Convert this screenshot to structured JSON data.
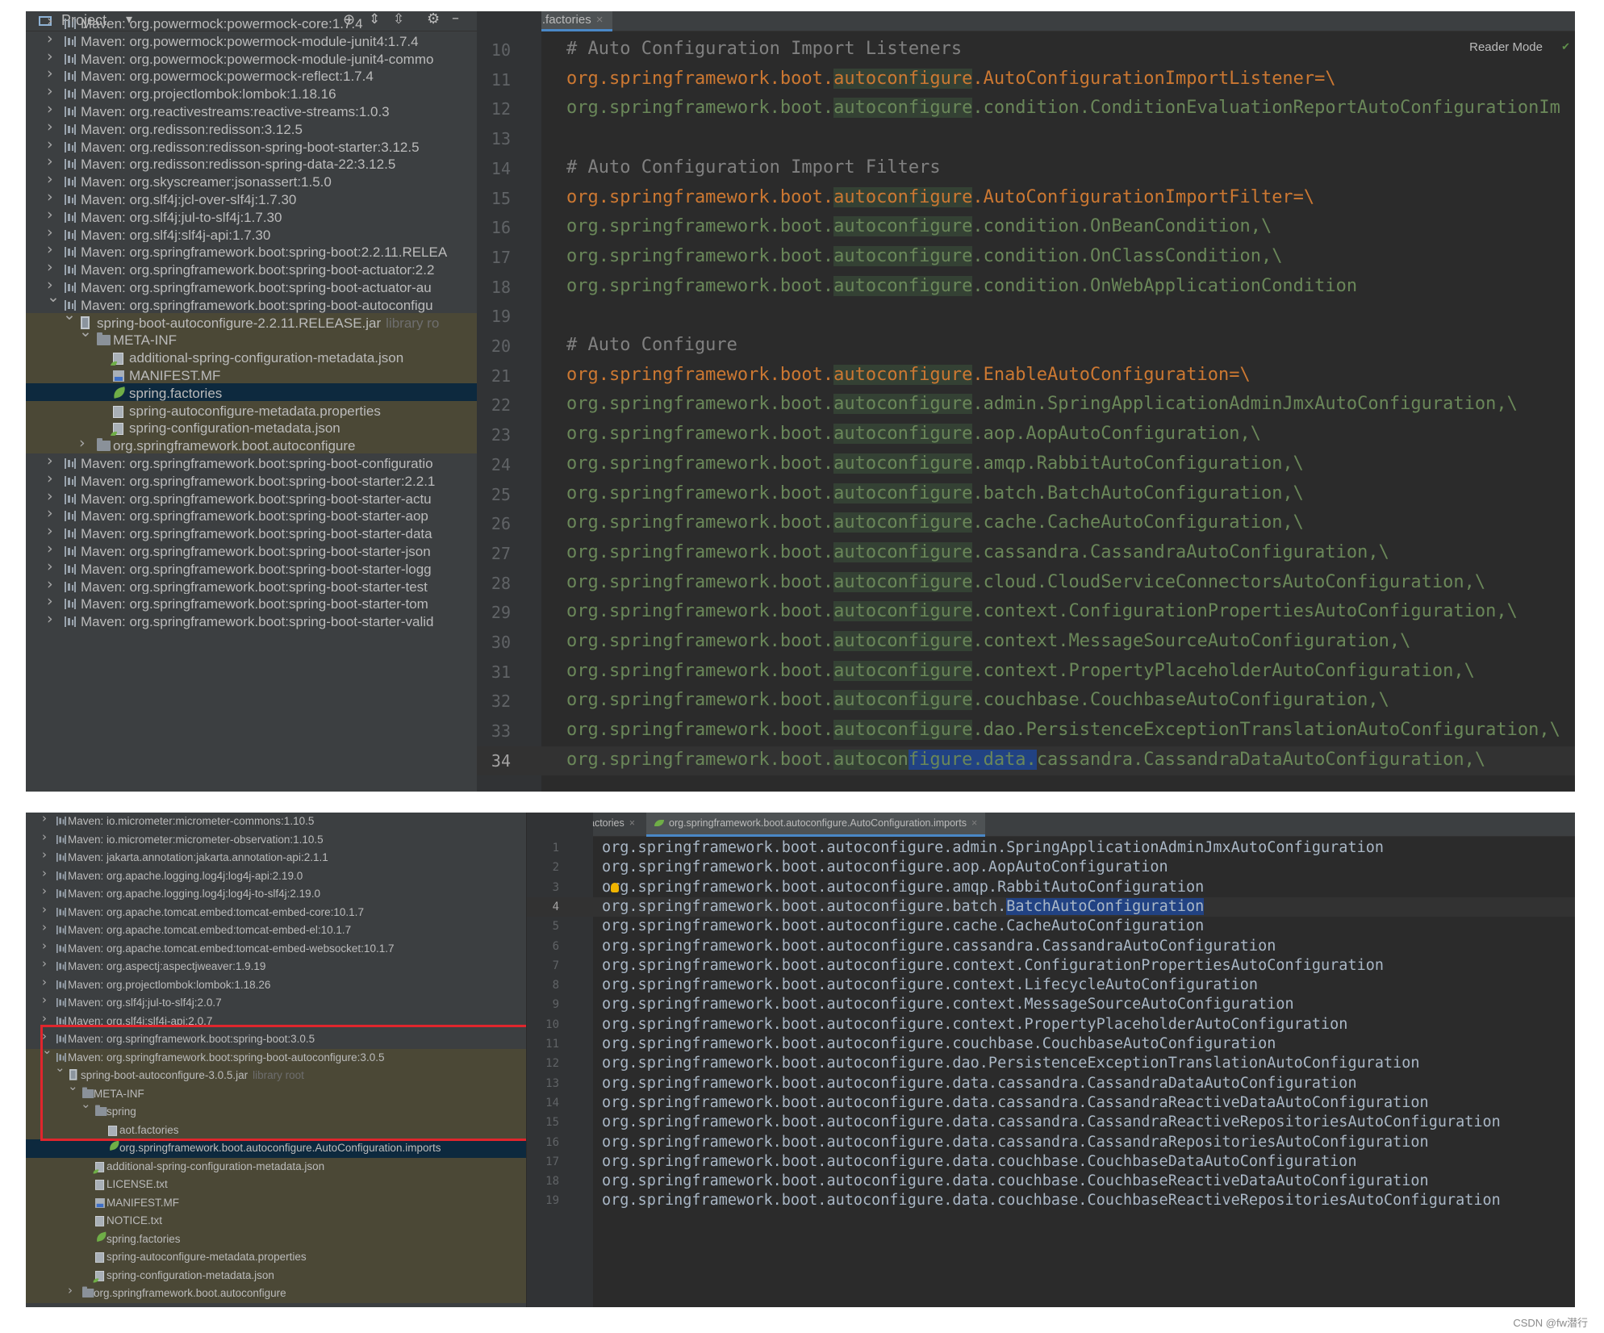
{
  "shot1": {
    "panel_title": "Project",
    "tree_rows": [
      {
        "arrow": "›",
        "icon": "lib",
        "text": "Maven: org.powermock:powermock-core:1.7.4"
      },
      {
        "arrow": "›",
        "icon": "lib",
        "text": "Maven: org.powermock:powermock-module-junit4:1.7.4"
      },
      {
        "arrow": "›",
        "icon": "lib",
        "text": "Maven: org.powermock:powermock-module-junit4-commo"
      },
      {
        "arrow": "›",
        "icon": "lib",
        "text": "Maven: org.powermock:powermock-reflect:1.7.4"
      },
      {
        "arrow": "›",
        "icon": "lib",
        "text": "Maven: org.projectlombok:lombok:1.18.16"
      },
      {
        "arrow": "›",
        "icon": "lib",
        "text": "Maven: org.reactivestreams:reactive-streams:1.0.3"
      },
      {
        "arrow": "›",
        "icon": "lib",
        "text": "Maven: org.redisson:redisson:3.12.5"
      },
      {
        "arrow": "›",
        "icon": "lib",
        "text": "Maven: org.redisson:redisson-spring-boot-starter:3.12.5"
      },
      {
        "arrow": "›",
        "icon": "lib",
        "text": "Maven: org.redisson:redisson-spring-data-22:3.12.5"
      },
      {
        "arrow": "›",
        "icon": "lib",
        "text": "Maven: org.skyscreamer:jsonassert:1.5.0"
      },
      {
        "arrow": "›",
        "icon": "lib",
        "text": "Maven: org.slf4j:jcl-over-slf4j:1.7.30"
      },
      {
        "arrow": "›",
        "icon": "lib",
        "text": "Maven: org.slf4j:jul-to-slf4j:1.7.30"
      },
      {
        "arrow": "›",
        "icon": "lib",
        "text": "Maven: org.slf4j:slf4j-api:1.7.30"
      },
      {
        "arrow": "›",
        "icon": "lib",
        "text": "Maven: org.springframework.boot:spring-boot:2.2.11.RELEA"
      },
      {
        "arrow": "›",
        "icon": "lib",
        "text": "Maven: org.springframework.boot:spring-boot-actuator:2.2"
      },
      {
        "arrow": "›",
        "icon": "lib",
        "text": "Maven: org.springframework.boot:spring-boot-actuator-au"
      },
      {
        "arrow": "⌄",
        "icon": "lib",
        "text": "Maven: org.springframework.boot:spring-boot-autoconfigu"
      },
      {
        "arrow": "⌄",
        "icon": "jar",
        "text": "spring-boot-autoconfigure-2.2.11.RELEASE.jar",
        "lib": "library ro"
      },
      {
        "arrow": "⌄",
        "icon": "folder",
        "text": "META-INF"
      },
      {
        "arrow": "",
        "icon": "json",
        "text": "additional-spring-configuration-metadata.json"
      },
      {
        "arrow": "",
        "icon": "mf",
        "text": "MANIFEST.MF"
      },
      {
        "arrow": "",
        "icon": "leaf",
        "text": "spring.factories"
      },
      {
        "arrow": "",
        "icon": "file",
        "text": "spring-autoconfigure-metadata.properties"
      },
      {
        "arrow": "",
        "icon": "json",
        "text": "spring-configuration-metadata.json"
      },
      {
        "arrow": "›",
        "icon": "folder",
        "text": "org.springframework.boot.autoconfigure"
      },
      {
        "arrow": "›",
        "icon": "lib",
        "text": "Maven: org.springframework.boot:spring-boot-configuratio"
      },
      {
        "arrow": "›",
        "icon": "lib",
        "text": "Maven: org.springframework.boot:spring-boot-starter:2.2.1"
      },
      {
        "arrow": "›",
        "icon": "lib",
        "text": "Maven: org.springframework.boot:spring-boot-starter-actu"
      },
      {
        "arrow": "›",
        "icon": "lib",
        "text": "Maven: org.springframework.boot:spring-boot-starter-aop"
      },
      {
        "arrow": "›",
        "icon": "lib",
        "text": "Maven: org.springframework.boot:spring-boot-starter-data"
      },
      {
        "arrow": "›",
        "icon": "lib",
        "text": "Maven: org.springframework.boot:spring-boot-starter-json"
      },
      {
        "arrow": "›",
        "icon": "lib",
        "text": "Maven: org.springframework.boot:spring-boot-starter-logg"
      },
      {
        "arrow": "›",
        "icon": "lib",
        "text": "Maven: org.springframework.boot:spring-boot-starter-test"
      },
      {
        "arrow": "›",
        "icon": "lib",
        "text": "Maven: org.springframework.boot:spring-boot-starter-tom"
      },
      {
        "arrow": "›",
        "icon": "lib",
        "text": "Maven: org.springframework.boot:spring-boot-starter-valid"
      }
    ],
    "tab_label": "spring.factories",
    "reader_mode": "Reader Mode",
    "lines": [
      {
        "n": "10",
        "kind": "comment",
        "text": "# Auto Configuration Import Listeners"
      },
      {
        "n": "11",
        "kind": "key",
        "pre": "org.springframework.boot.",
        "ac": "autoconfigure",
        "post": ".AutoConfigurationImportListener=\\"
      },
      {
        "n": "12",
        "kind": "val",
        "pre": "org.springframework.boot.",
        "ac": "autoconfigure",
        "post": ".condition.ConditionEvaluationReportAutoConfigurationIm"
      },
      {
        "n": "13",
        "kind": "blank",
        "text": ""
      },
      {
        "n": "14",
        "kind": "comment",
        "text": "# Auto Configuration Import Filters"
      },
      {
        "n": "15",
        "kind": "key",
        "pre": "org.springframework.boot.",
        "ac": "autoconfigure",
        "post": ".AutoConfigurationImportFilter=\\"
      },
      {
        "n": "16",
        "kind": "val",
        "pre": "org.springframework.boot.",
        "ac": "autoconfigure",
        "post": ".condition.OnBeanCondition,\\"
      },
      {
        "n": "17",
        "kind": "val",
        "pre": "org.springframework.boot.",
        "ac": "autoconfigure",
        "post": ".condition.OnClassCondition,\\"
      },
      {
        "n": "18",
        "kind": "val",
        "pre": "org.springframework.boot.",
        "ac": "autoconfigure",
        "post": ".condition.OnWebApplicationCondition"
      },
      {
        "n": "19",
        "kind": "blank",
        "text": ""
      },
      {
        "n": "20",
        "kind": "comment",
        "text": "# Auto Configure"
      },
      {
        "n": "21",
        "kind": "key",
        "pre": "org.springframework.boot.",
        "ac": "autoconfigure",
        "post": ".EnableAutoConfiguration=\\"
      },
      {
        "n": "22",
        "kind": "val",
        "pre": "org.springframework.boot.",
        "ac": "autoconfigure",
        "post": ".admin.SpringApplicationAdminJmxAutoConfiguration,\\"
      },
      {
        "n": "23",
        "kind": "val",
        "pre": "org.springframework.boot.",
        "ac": "autoconfigure",
        "post": ".aop.AopAutoConfiguration,\\"
      },
      {
        "n": "24",
        "kind": "val",
        "pre": "org.springframework.boot.",
        "ac": "autoconfigure",
        "post": ".amqp.RabbitAutoConfiguration,\\"
      },
      {
        "n": "25",
        "kind": "val",
        "pre": "org.springframework.boot.",
        "ac": "autoconfigure",
        "post": ".batch.BatchAutoConfiguration,\\"
      },
      {
        "n": "26",
        "kind": "val",
        "pre": "org.springframework.boot.",
        "ac": "autoconfigure",
        "post": ".cache.CacheAutoConfiguration,\\"
      },
      {
        "n": "27",
        "kind": "val",
        "pre": "org.springframework.boot.",
        "ac": "autoconfigure",
        "post": ".cassandra.CassandraAutoConfiguration,\\"
      },
      {
        "n": "28",
        "kind": "val",
        "pre": "org.springframework.boot.",
        "ac": "autoconfigure",
        "post": ".cloud.CloudServiceConnectorsAutoConfiguration,\\"
      },
      {
        "n": "29",
        "kind": "val",
        "pre": "org.springframework.boot.",
        "ac": "autoconfigure",
        "post": ".context.ConfigurationPropertiesAutoConfiguration,\\"
      },
      {
        "n": "30",
        "kind": "val",
        "pre": "org.springframework.boot.",
        "ac": "autoconfigure",
        "post": ".context.MessageSourceAutoConfiguration,\\"
      },
      {
        "n": "31",
        "kind": "val",
        "pre": "org.springframework.boot.",
        "ac": "autoconfigure",
        "post": ".context.PropertyPlaceholderAutoConfiguration,\\"
      },
      {
        "n": "32",
        "kind": "val",
        "pre": "org.springframework.boot.",
        "ac": "autoconfigure",
        "post": ".couchbase.CouchbaseAutoConfiguration,\\"
      },
      {
        "n": "33",
        "kind": "val",
        "pre": "org.springframework.boot.",
        "ac": "autoconfigure",
        "post": ".dao.PersistenceExceptionTranslationAutoConfiguration,\\"
      },
      {
        "n": "34",
        "kind": "sel",
        "pre": "org.springframework.boot.",
        "ac1": "autocon",
        "sel": "figure.data.",
        "post": "cassandra.CassandraDataAutoConfiguration,\\"
      }
    ]
  },
  "shot2": {
    "tree_rows": [
      {
        "arrow": "›",
        "icon": "lib",
        "text": "Maven: io.micrometer:micrometer-commons:1.10.5"
      },
      {
        "arrow": "›",
        "icon": "lib",
        "text": "Maven: io.micrometer:micrometer-observation:1.10.5"
      },
      {
        "arrow": "›",
        "icon": "lib",
        "text": "Maven: jakarta.annotation:jakarta.annotation-api:2.1.1"
      },
      {
        "arrow": "›",
        "icon": "lib",
        "text": "Maven: org.apache.logging.log4j:log4j-api:2.19.0"
      },
      {
        "arrow": "›",
        "icon": "lib",
        "text": "Maven: org.apache.logging.log4j:log4j-to-slf4j:2.19.0"
      },
      {
        "arrow": "›",
        "icon": "lib",
        "text": "Maven: org.apache.tomcat.embed:tomcat-embed-core:10.1.7"
      },
      {
        "arrow": "›",
        "icon": "lib",
        "text": "Maven: org.apache.tomcat.embed:tomcat-embed-el:10.1.7"
      },
      {
        "arrow": "›",
        "icon": "lib",
        "text": "Maven: org.apache.tomcat.embed:tomcat-embed-websocket:10.1.7"
      },
      {
        "arrow": "›",
        "icon": "lib",
        "text": "Maven: org.aspectj:aspectjweaver:1.9.19"
      },
      {
        "arrow": "›",
        "icon": "lib",
        "text": "Maven: org.projectlombok:lombok:1.18.26"
      },
      {
        "arrow": "›",
        "icon": "lib",
        "text": "Maven: org.slf4j:jul-to-slf4j:2.0.7"
      },
      {
        "arrow": "›",
        "icon": "lib",
        "text": "Maven: org.slf4j:slf4j-api:2.0.7"
      },
      {
        "arrow": "›",
        "icon": "lib",
        "text": "Maven: org.springframework.boot:spring-boot:3.0.5"
      },
      {
        "arrow": "⌄",
        "icon": "lib",
        "text": "Maven: org.springframework.boot:spring-boot-autoconfigure:3.0.5"
      },
      {
        "arrow": "⌄",
        "icon": "jar",
        "text": "spring-boot-autoconfigure-3.0.5.jar",
        "lib": "library root"
      },
      {
        "arrow": "⌄",
        "icon": "folder",
        "text": "META-INF"
      },
      {
        "arrow": "⌄",
        "icon": "folder",
        "text": "spring"
      },
      {
        "arrow": "",
        "icon": "file",
        "text": "aot.factories"
      },
      {
        "arrow": "",
        "icon": "leaf",
        "text": "org.springframework.boot.autoconfigure.AutoConfiguration.imports"
      },
      {
        "arrow": "",
        "icon": "json",
        "text": "additional-spring-configuration-metadata.json"
      },
      {
        "arrow": "",
        "icon": "file",
        "text": "LICENSE.txt"
      },
      {
        "arrow": "",
        "icon": "mf",
        "text": "MANIFEST.MF"
      },
      {
        "arrow": "",
        "icon": "file",
        "text": "NOTICE.txt"
      },
      {
        "arrow": "",
        "icon": "leaf",
        "text": "spring.factories"
      },
      {
        "arrow": "",
        "icon": "file",
        "text": "spring-autoconfigure-metadata.properties"
      },
      {
        "arrow": "",
        "icon": "json",
        "text": "spring-configuration-metadata.json"
      },
      {
        "arrow": "›",
        "icon": "folder",
        "text": "org.springframework.boot.autoconfigure"
      }
    ],
    "tabs": [
      {
        "label": "spring.factories",
        "close": "×"
      },
      {
        "label": "org.springframework.boot.autoconfigure.AutoConfiguration.imports",
        "close": "×"
      }
    ],
    "lines": [
      {
        "n": "1",
        "text": "org.springframework.boot.autoconfigure.admin.SpringApplicationAdminJmxAutoConfiguration"
      },
      {
        "n": "2",
        "text": "org.springframework.boot.autoconfigure.aop.AopAutoConfiguration"
      },
      {
        "n": "3",
        "text": "org.springframework.boot.autoconfigure.amqp.RabbitAutoConfiguration"
      },
      {
        "n": "4",
        "pre": "org.springframework.boot.autoconfigure.batch.",
        "sel": "BatchAutoConfiguration"
      },
      {
        "n": "5",
        "text": "org.springframework.boot.autoconfigure.cache.CacheAutoConfiguration"
      },
      {
        "n": "6",
        "text": "org.springframework.boot.autoconfigure.cassandra.CassandraAutoConfiguration"
      },
      {
        "n": "7",
        "text": "org.springframework.boot.autoconfigure.context.ConfigurationPropertiesAutoConfiguration"
      },
      {
        "n": "8",
        "text": "org.springframework.boot.autoconfigure.context.LifecycleAutoConfiguration"
      },
      {
        "n": "9",
        "text": "org.springframework.boot.autoconfigure.context.MessageSourceAutoConfiguration"
      },
      {
        "n": "10",
        "text": "org.springframework.boot.autoconfigure.context.PropertyPlaceholderAutoConfiguration"
      },
      {
        "n": "11",
        "text": "org.springframework.boot.autoconfigure.couchbase.CouchbaseAutoConfiguration"
      },
      {
        "n": "12",
        "text": "org.springframework.boot.autoconfigure.dao.PersistenceExceptionTranslationAutoConfiguration"
      },
      {
        "n": "13",
        "text": "org.springframework.boot.autoconfigure.data.cassandra.CassandraDataAutoConfiguration"
      },
      {
        "n": "14",
        "text": "org.springframework.boot.autoconfigure.data.cassandra.CassandraReactiveDataAutoConfiguration"
      },
      {
        "n": "15",
        "text": "org.springframework.boot.autoconfigure.data.cassandra.CassandraReactiveRepositoriesAutoConfiguration"
      },
      {
        "n": "16",
        "text": "org.springframework.boot.autoconfigure.data.cassandra.CassandraRepositoriesAutoConfiguration"
      },
      {
        "n": "17",
        "text": "org.springframework.boot.autoconfigure.data.couchbase.CouchbaseDataAutoConfiguration"
      },
      {
        "n": "18",
        "text": "org.springframework.boot.autoconfigure.data.couchbase.CouchbaseReactiveDataAutoConfiguration"
      },
      {
        "n": "19",
        "text": "org.springframework.boot.autoconfigure.data.couchbase.CouchbaseReactiveRepositoriesAutoConfiguration"
      }
    ]
  },
  "watermark": "CSDN @fw潜行",
  "colors": {
    "accent_red": "#e0262d",
    "selection": "#214283",
    "key_orange": "#cc7832",
    "value_green": "#6a8759"
  }
}
